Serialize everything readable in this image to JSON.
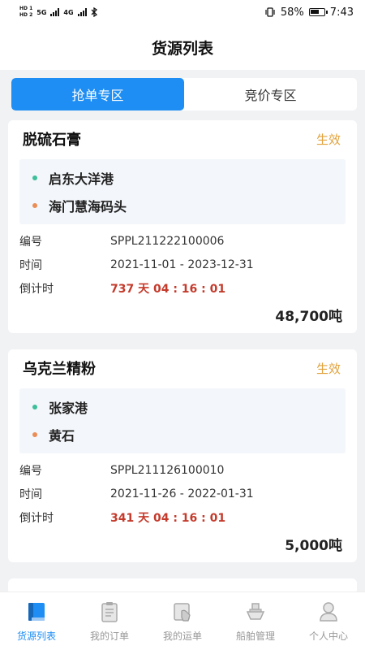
{
  "status_bar": {
    "hd1": "HD 1",
    "hd2": "HD 2",
    "net1": "5G",
    "net2": "4G",
    "battery": "58%",
    "time": "7:43"
  },
  "header": {
    "title": "货源列表"
  },
  "tabs": [
    {
      "label": "抢单专区",
      "active": true
    },
    {
      "label": "竞价专区",
      "active": false
    }
  ],
  "labels": {
    "number": "编号",
    "time": "时间",
    "countdown": "倒计时"
  },
  "cards": [
    {
      "title": "脱硫石膏",
      "status": "生效",
      "origin": "启东大洋港",
      "destination": "海门慧海码头",
      "number": "SPPL211222100006",
      "period": "2021-11-01 - 2023-12-31",
      "countdown": "737 天 04 : 16 : 01",
      "weight": "48,700吨"
    },
    {
      "title": "乌克兰精粉",
      "status": "生效",
      "origin": "张家港",
      "destination": "黄石",
      "number": "SPPL211126100010",
      "period": "2021-11-26 - 2022-01-31",
      "countdown": "341 天 04 : 16 : 01",
      "weight": "5,000吨"
    }
  ],
  "nav": [
    {
      "label": "货源列表",
      "icon": "book-icon",
      "active": true
    },
    {
      "label": "我的订单",
      "icon": "clipboard-icon",
      "active": false
    },
    {
      "label": "我的运单",
      "icon": "waybill-icon",
      "active": false
    },
    {
      "label": "船舶管理",
      "icon": "ship-icon",
      "active": false
    },
    {
      "label": "个人中心",
      "icon": "user-icon",
      "active": false
    }
  ],
  "colors": {
    "accent": "#1e8ef4",
    "status": "#e2a23b",
    "countdown": "#c43a2b",
    "dot_origin": "#3dbf9b",
    "dot_destination": "#ea8d57"
  }
}
